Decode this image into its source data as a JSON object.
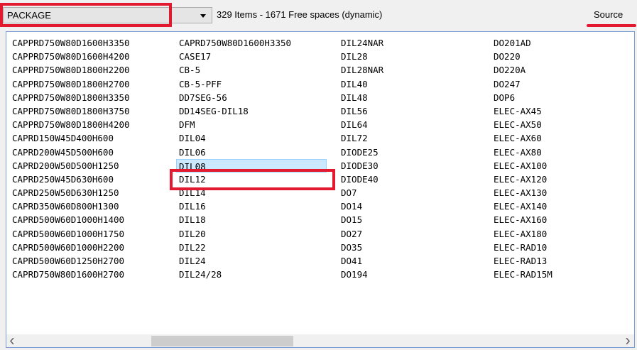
{
  "toolbar": {
    "combo_value": "PACKAGE",
    "status": "329 Items - 1671 Free spaces (dynamic)",
    "source_label": "Source"
  },
  "list": {
    "columns": [
      [
        "CAPPRD750W80D1600H3350",
        "CAPPRD750W80D1600H4200",
        "CAPPRD750W80D1800H2200",
        "CAPPRD750W80D1800H2700",
        "CAPPRD750W80D1800H3350",
        "CAPPRD750W80D1800H3750",
        "CAPPRD750W80D1800H4200",
        "CAPRD150W45D400H600",
        "CAPRD200W45D500H600",
        "CAPRD200W50D500H1250",
        "CAPRD250W45D630H600",
        "CAPRD250W50D630H1250",
        "CAPRD350W60D800H1300",
        "CAPRD500W60D1000H1400",
        "CAPRD500W60D1000H1750",
        "CAPRD500W60D1000H2200",
        "CAPRD500W60D1250H2700",
        "CAPRD750W80D1600H2700"
      ],
      [
        "CAPRD750W80D1600H3350",
        "CASE17",
        "CB-5",
        "CB-5-PFF",
        "DD7SEG-56",
        "DD14SEG-DIL18",
        "DFM",
        "DIL04",
        "DIL06",
        "DIL08",
        "DIL12",
        "DIL14",
        "DIL16",
        "DIL18",
        "DIL20",
        "DIL22",
        "DIL24",
        "DIL24/28"
      ],
      [
        "DIL24NAR",
        "DIL28",
        "DIL28NAR",
        "DIL40",
        "DIL48",
        "DIL56",
        "DIL64",
        "DIL72",
        "DIODE25",
        "DIODE30",
        "DIODE40",
        "DO7",
        "DO14",
        "DO15",
        "DO27",
        "DO35",
        "DO41",
        "DO194"
      ],
      [
        "DO201AD",
        "DO220",
        "DO220A",
        "DO247",
        "DOP6",
        "ELEC-AX45",
        "ELEC-AX50",
        "ELEC-AX60",
        "ELEC-AX80",
        "ELEC-AX100",
        "ELEC-AX120",
        "ELEC-AX130",
        "ELEC-AX140",
        "ELEC-AX160",
        "ELEC-AX180",
        "ELEC-RAD10",
        "ELEC-RAD13",
        "ELEC-RAD15M"
      ]
    ],
    "selected": "DIL08"
  },
  "colors": {
    "highlight": "#e3192f",
    "selection": "#cce8ff",
    "border": "#7a9cd3"
  },
  "icons": {
    "combo": "chevron-down-icon",
    "scroll_left": "chevron-left-icon",
    "scroll_right": "chevron-right-icon"
  }
}
